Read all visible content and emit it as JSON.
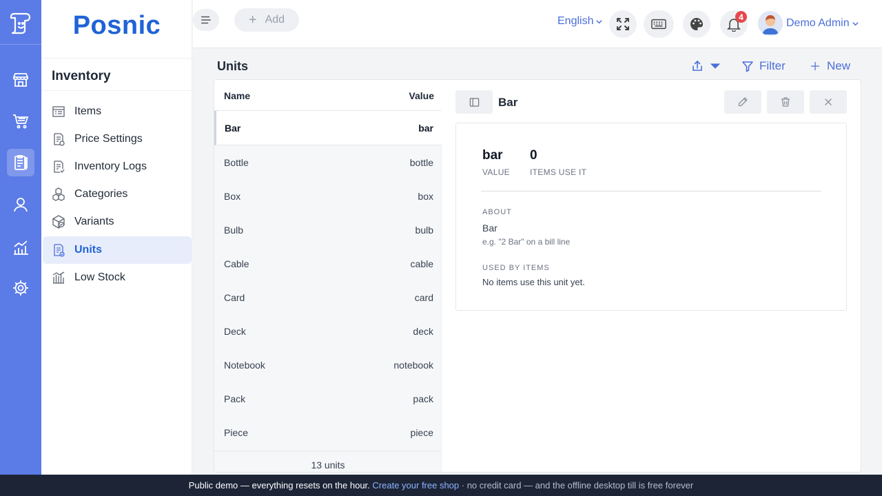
{
  "brand": {
    "name": "Posnic"
  },
  "sidebar": {
    "section_title": "Inventory",
    "items": [
      {
        "label": "Items",
        "icon": "items-icon"
      },
      {
        "label": "Price Settings",
        "icon": "price-settings-icon"
      },
      {
        "label": "Inventory Logs",
        "icon": "inventory-logs-icon"
      },
      {
        "label": "Categories",
        "icon": "categories-icon"
      },
      {
        "label": "Variants",
        "icon": "variants-icon"
      },
      {
        "label": "Units",
        "icon": "units-icon",
        "active": true
      },
      {
        "label": "Low Stock",
        "icon": "low-stock-icon"
      }
    ]
  },
  "header": {
    "add_label": "Add",
    "language": "English",
    "notifications_count": "4",
    "user_name": "Demo Admin"
  },
  "page": {
    "title": "Units",
    "filter_label": "Filter",
    "new_label": "New"
  },
  "list": {
    "col_name": "Name",
    "col_value": "Value",
    "rows": [
      {
        "name": "Bar",
        "value": "bar"
      },
      {
        "name": "Bottle",
        "value": "bottle"
      },
      {
        "name": "Box",
        "value": "box"
      },
      {
        "name": "Bulb",
        "value": "bulb"
      },
      {
        "name": "Cable",
        "value": "cable"
      },
      {
        "name": "Card",
        "value": "card"
      },
      {
        "name": "Deck",
        "value": "deck"
      },
      {
        "name": "Notebook",
        "value": "notebook"
      },
      {
        "name": "Pack",
        "value": "pack"
      },
      {
        "name": "Piece",
        "value": "piece"
      }
    ],
    "footer": "13 units"
  },
  "detail": {
    "title": "Bar",
    "value": "bar",
    "value_label": "VALUE",
    "items_count": "0",
    "items_label": "ITEMS USE IT",
    "about_label": "ABOUT",
    "about_text": "Bar",
    "about_hint": "e.g. \"2 Bar\" on a bill line",
    "used_by_label": "USED BY ITEMS",
    "used_by_text": "No items use this unit yet."
  },
  "banner": {
    "text_before": "Public demo — everything resets on the hour. ",
    "link": "Create your free shop",
    "text_after": " · no credit card — and the offline desktop till is free forever"
  },
  "colors": {
    "accent": "#4b6fd8",
    "brand": "#1f63d6",
    "rail": "#5b7be6",
    "banner": "#1c2436",
    "badge": "#e5484d"
  }
}
